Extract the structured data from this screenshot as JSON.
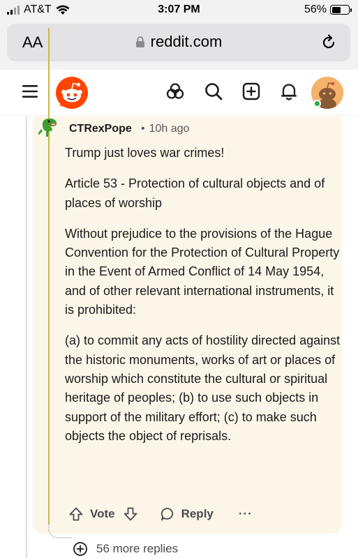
{
  "status_bar": {
    "carrier": "AT&T",
    "time": "3:07 PM",
    "battery_percent": "56%",
    "battery_level": 0.56
  },
  "browser": {
    "text_size_button": "AA",
    "url": "reddit.com"
  },
  "header": {
    "icons": [
      "menu-icon",
      "reddit-logo",
      "explore-icon",
      "search-icon",
      "create-post-icon",
      "notifications-icon",
      "user-avatar"
    ],
    "online": true
  },
  "comment": {
    "author": "CTRexPope",
    "separator": "•",
    "time_ago": "10h ago",
    "paragraphs": [
      "Trump just loves war crimes!",
      "Article 53 - Protection of cultural objects and of places of worship",
      "Without prejudice to the provisions of the Hague Convention for the Protection of Cultural Property in the Event of Armed Conflict of 14 May 1954, and of other relevant international instruments, it is prohibited:",
      "(a) to commit any acts of hostility directed against the historic monuments, works of art or places of worship which constitute the cultural or spiritual heritage of peoples; (b) to use such objects in support of the military effort; (c) to make such objects the object of reprisals."
    ],
    "actions": {
      "vote_label": "Vote",
      "reply_label": "Reply",
      "more_label": "···"
    },
    "more_replies": "56 more replies"
  },
  "colors": {
    "reddit_orange": "#ff4500",
    "card_highlight": "#fcf6e9",
    "thread_highlight": "#c9b84a",
    "online_green": "#2aa745"
  }
}
